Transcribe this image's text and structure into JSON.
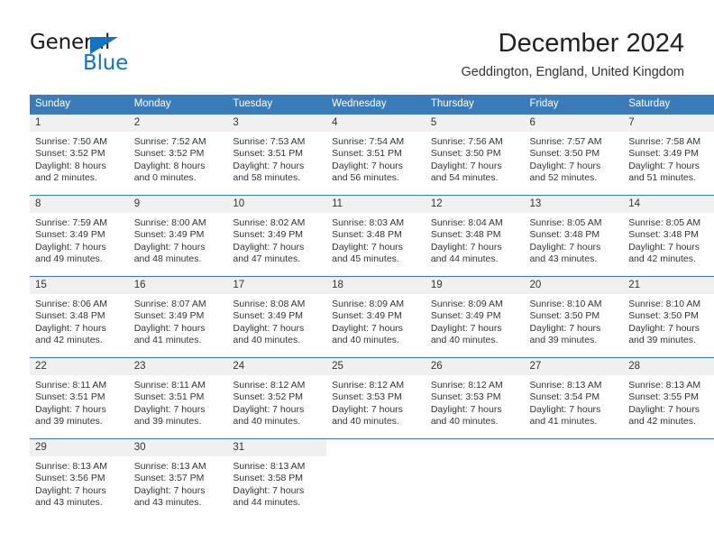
{
  "logo": {
    "word1": "General",
    "word2": "Blue",
    "triangle_color": "#1272c4",
    "icon": "triangle-icon"
  },
  "header": {
    "title": "December 2024",
    "subtitle": "Geddington, England, United Kingdom"
  },
  "colors": {
    "header_blue": "#3a7cba",
    "daynum_bg": "#f0f0f0",
    "text": "#333333"
  },
  "weekdays": [
    "Sunday",
    "Monday",
    "Tuesday",
    "Wednesday",
    "Thursday",
    "Friday",
    "Saturday"
  ],
  "weeks": [
    [
      {
        "day": "1",
        "sunrise": "Sunrise: 7:50 AM",
        "sunset": "Sunset: 3:52 PM",
        "daylight1": "Daylight: 8 hours",
        "daylight2": "and 2 minutes."
      },
      {
        "day": "2",
        "sunrise": "Sunrise: 7:52 AM",
        "sunset": "Sunset: 3:52 PM",
        "daylight1": "Daylight: 8 hours",
        "daylight2": "and 0 minutes."
      },
      {
        "day": "3",
        "sunrise": "Sunrise: 7:53 AM",
        "sunset": "Sunset: 3:51 PM",
        "daylight1": "Daylight: 7 hours",
        "daylight2": "and 58 minutes."
      },
      {
        "day": "4",
        "sunrise": "Sunrise: 7:54 AM",
        "sunset": "Sunset: 3:51 PM",
        "daylight1": "Daylight: 7 hours",
        "daylight2": "and 56 minutes."
      },
      {
        "day": "5",
        "sunrise": "Sunrise: 7:56 AM",
        "sunset": "Sunset: 3:50 PM",
        "daylight1": "Daylight: 7 hours",
        "daylight2": "and 54 minutes."
      },
      {
        "day": "6",
        "sunrise": "Sunrise: 7:57 AM",
        "sunset": "Sunset: 3:50 PM",
        "daylight1": "Daylight: 7 hours",
        "daylight2": "and 52 minutes."
      },
      {
        "day": "7",
        "sunrise": "Sunrise: 7:58 AM",
        "sunset": "Sunset: 3:49 PM",
        "daylight1": "Daylight: 7 hours",
        "daylight2": "and 51 minutes."
      }
    ],
    [
      {
        "day": "8",
        "sunrise": "Sunrise: 7:59 AM",
        "sunset": "Sunset: 3:49 PM",
        "daylight1": "Daylight: 7 hours",
        "daylight2": "and 49 minutes."
      },
      {
        "day": "9",
        "sunrise": "Sunrise: 8:00 AM",
        "sunset": "Sunset: 3:49 PM",
        "daylight1": "Daylight: 7 hours",
        "daylight2": "and 48 minutes."
      },
      {
        "day": "10",
        "sunrise": "Sunrise: 8:02 AM",
        "sunset": "Sunset: 3:49 PM",
        "daylight1": "Daylight: 7 hours",
        "daylight2": "and 47 minutes."
      },
      {
        "day": "11",
        "sunrise": "Sunrise: 8:03 AM",
        "sunset": "Sunset: 3:48 PM",
        "daylight1": "Daylight: 7 hours",
        "daylight2": "and 45 minutes."
      },
      {
        "day": "12",
        "sunrise": "Sunrise: 8:04 AM",
        "sunset": "Sunset: 3:48 PM",
        "daylight1": "Daylight: 7 hours",
        "daylight2": "and 44 minutes."
      },
      {
        "day": "13",
        "sunrise": "Sunrise: 8:05 AM",
        "sunset": "Sunset: 3:48 PM",
        "daylight1": "Daylight: 7 hours",
        "daylight2": "and 43 minutes."
      },
      {
        "day": "14",
        "sunrise": "Sunrise: 8:05 AM",
        "sunset": "Sunset: 3:48 PM",
        "daylight1": "Daylight: 7 hours",
        "daylight2": "and 42 minutes."
      }
    ],
    [
      {
        "day": "15",
        "sunrise": "Sunrise: 8:06 AM",
        "sunset": "Sunset: 3:48 PM",
        "daylight1": "Daylight: 7 hours",
        "daylight2": "and 42 minutes."
      },
      {
        "day": "16",
        "sunrise": "Sunrise: 8:07 AM",
        "sunset": "Sunset: 3:49 PM",
        "daylight1": "Daylight: 7 hours",
        "daylight2": "and 41 minutes."
      },
      {
        "day": "17",
        "sunrise": "Sunrise: 8:08 AM",
        "sunset": "Sunset: 3:49 PM",
        "daylight1": "Daylight: 7 hours",
        "daylight2": "and 40 minutes."
      },
      {
        "day": "18",
        "sunrise": "Sunrise: 8:09 AM",
        "sunset": "Sunset: 3:49 PM",
        "daylight1": "Daylight: 7 hours",
        "daylight2": "and 40 minutes."
      },
      {
        "day": "19",
        "sunrise": "Sunrise: 8:09 AM",
        "sunset": "Sunset: 3:49 PM",
        "daylight1": "Daylight: 7 hours",
        "daylight2": "and 40 minutes."
      },
      {
        "day": "20",
        "sunrise": "Sunrise: 8:10 AM",
        "sunset": "Sunset: 3:50 PM",
        "daylight1": "Daylight: 7 hours",
        "daylight2": "and 39 minutes."
      },
      {
        "day": "21",
        "sunrise": "Sunrise: 8:10 AM",
        "sunset": "Sunset: 3:50 PM",
        "daylight1": "Daylight: 7 hours",
        "daylight2": "and 39 minutes."
      }
    ],
    [
      {
        "day": "22",
        "sunrise": "Sunrise: 8:11 AM",
        "sunset": "Sunset: 3:51 PM",
        "daylight1": "Daylight: 7 hours",
        "daylight2": "and 39 minutes."
      },
      {
        "day": "23",
        "sunrise": "Sunrise: 8:11 AM",
        "sunset": "Sunset: 3:51 PM",
        "daylight1": "Daylight: 7 hours",
        "daylight2": "and 39 minutes."
      },
      {
        "day": "24",
        "sunrise": "Sunrise: 8:12 AM",
        "sunset": "Sunset: 3:52 PM",
        "daylight1": "Daylight: 7 hours",
        "daylight2": "and 40 minutes."
      },
      {
        "day": "25",
        "sunrise": "Sunrise: 8:12 AM",
        "sunset": "Sunset: 3:53 PM",
        "daylight1": "Daylight: 7 hours",
        "daylight2": "and 40 minutes."
      },
      {
        "day": "26",
        "sunrise": "Sunrise: 8:12 AM",
        "sunset": "Sunset: 3:53 PM",
        "daylight1": "Daylight: 7 hours",
        "daylight2": "and 40 minutes."
      },
      {
        "day": "27",
        "sunrise": "Sunrise: 8:13 AM",
        "sunset": "Sunset: 3:54 PM",
        "daylight1": "Daylight: 7 hours",
        "daylight2": "and 41 minutes."
      },
      {
        "day": "28",
        "sunrise": "Sunrise: 8:13 AM",
        "sunset": "Sunset: 3:55 PM",
        "daylight1": "Daylight: 7 hours",
        "daylight2": "and 42 minutes."
      }
    ],
    [
      {
        "day": "29",
        "sunrise": "Sunrise: 8:13 AM",
        "sunset": "Sunset: 3:56 PM",
        "daylight1": "Daylight: 7 hours",
        "daylight2": "and 43 minutes."
      },
      {
        "day": "30",
        "sunrise": "Sunrise: 8:13 AM",
        "sunset": "Sunset: 3:57 PM",
        "daylight1": "Daylight: 7 hours",
        "daylight2": "and 43 minutes."
      },
      {
        "day": "31",
        "sunrise": "Sunrise: 8:13 AM",
        "sunset": "Sunset: 3:58 PM",
        "daylight1": "Daylight: 7 hours",
        "daylight2": "and 44 minutes."
      },
      {
        "day": "",
        "sunrise": "",
        "sunset": "",
        "daylight1": "",
        "daylight2": ""
      },
      {
        "day": "",
        "sunrise": "",
        "sunset": "",
        "daylight1": "",
        "daylight2": ""
      },
      {
        "day": "",
        "sunrise": "",
        "sunset": "",
        "daylight1": "",
        "daylight2": ""
      },
      {
        "day": "",
        "sunrise": "",
        "sunset": "",
        "daylight1": "",
        "daylight2": ""
      }
    ]
  ]
}
